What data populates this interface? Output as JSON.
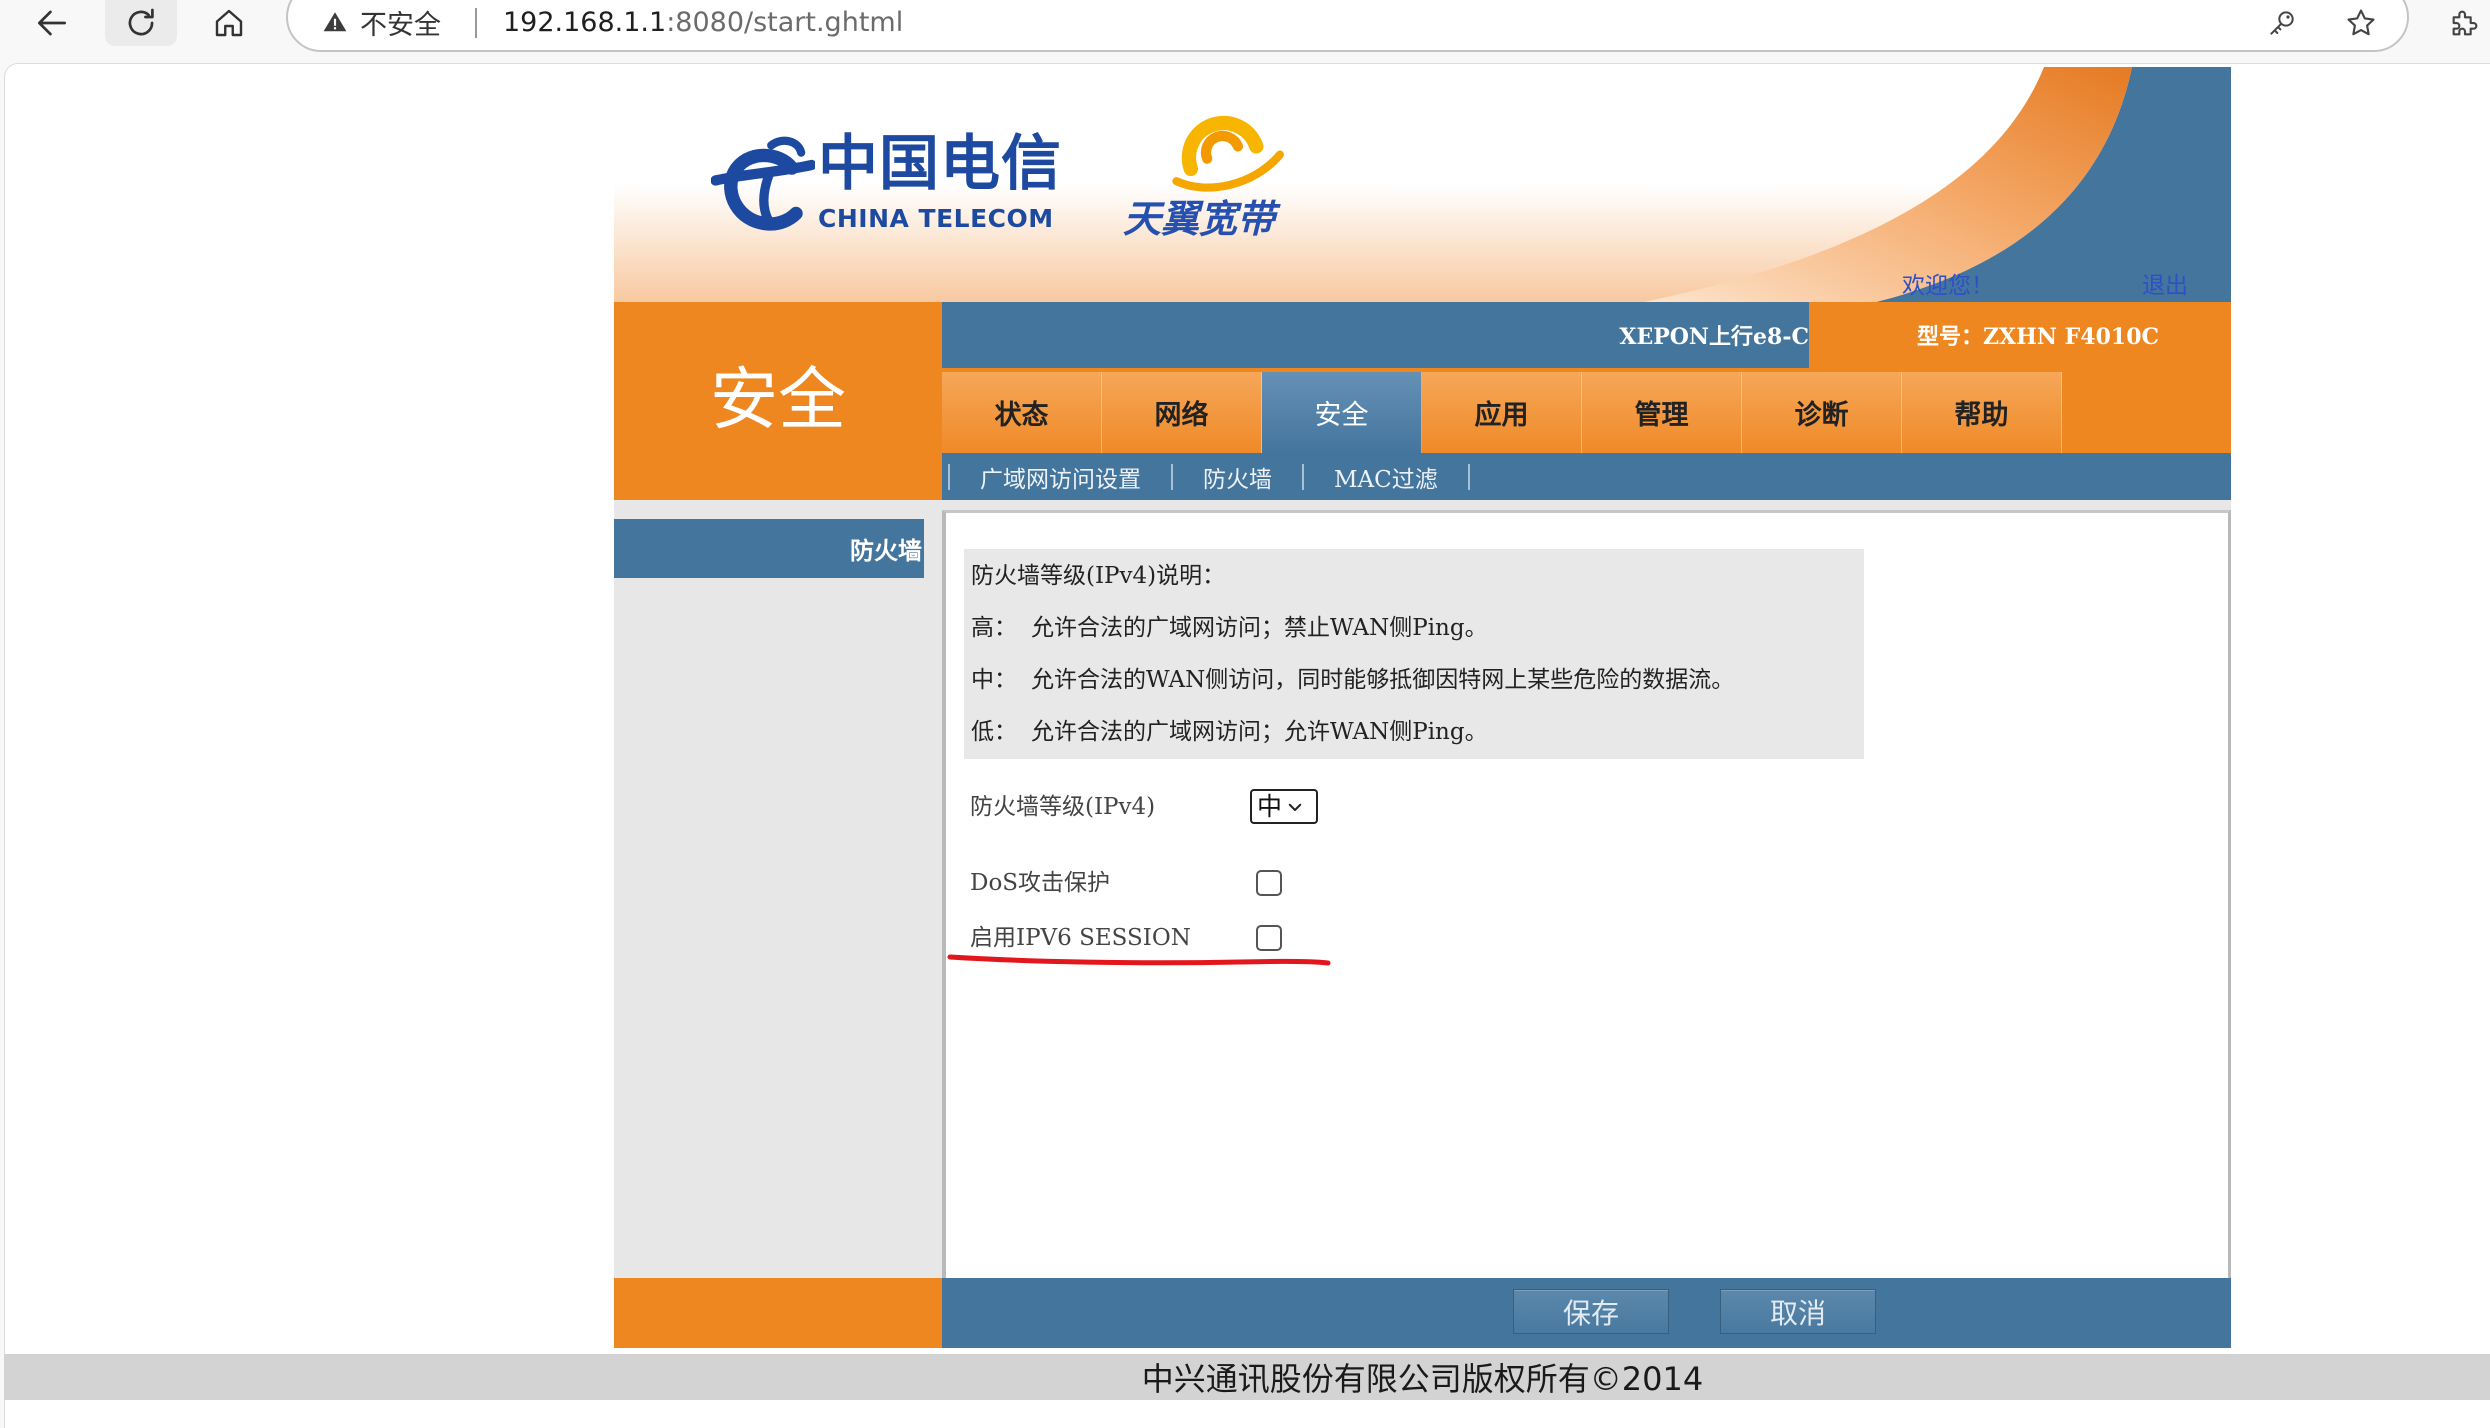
{
  "browser": {
    "security_label": "不安全",
    "url_host": "192.168.1.1",
    "url_path": ":8080/start.ghtml"
  },
  "icons": {
    "back": "back-arrow-icon",
    "reload": "reload-icon",
    "home": "home-icon",
    "security": "warning-triangle-icon",
    "password": "key-icon",
    "favorite": "star-icon",
    "extensions": "puzzle-icon",
    "logo": "china-telecom-logo-icon",
    "brand_logo": "tianyi-swirl-icon",
    "select_arrow": "chevron-down-icon"
  },
  "colors": {
    "orange": "#ef8720",
    "blue": "#44759d",
    "sidebar_gray": "#e7e7e7",
    "info_gray": "#e8e8e8",
    "annotation": "#e3161c",
    "logo_blue": "#1d4aa0",
    "welcome_blue": "#2f4fc8"
  },
  "header": {
    "logo_cn": "中国电信",
    "logo_en": "CHINA TELECOM",
    "brand": "天翼宽带",
    "welcome": "欢迎您！",
    "logout": "退出",
    "uplink": "XEPON上行e8-C",
    "model": "型号：ZXHN F4010C"
  },
  "section_title": "安全",
  "tabs": [
    {
      "label": "状态"
    },
    {
      "label": "网络"
    },
    {
      "label": "安全",
      "active": true
    },
    {
      "label": "应用"
    },
    {
      "label": "管理"
    },
    {
      "label": "诊断"
    },
    {
      "label": "帮助"
    }
  ],
  "subnav": [
    {
      "label": "广域网访问设置"
    },
    {
      "label": "防火墙"
    },
    {
      "label": "MAC过滤"
    }
  ],
  "sidebar": {
    "items": [
      {
        "label": "防火墙"
      }
    ]
  },
  "info": {
    "title": "防火墙等级(IPv4)说明：",
    "lines": [
      {
        "level": "高：",
        "text": "允许合法的广域网访问；禁止WAN侧Ping。"
      },
      {
        "level": "中：",
        "text": "允许合法的WAN侧访问，同时能够抵御因特网上某些危险的数据流。"
      },
      {
        "level": "低：",
        "text": "允许合法的广域网访问；允许WAN侧Ping。"
      }
    ]
  },
  "form": {
    "level_label": "防火墙等级(IPv4)",
    "level_value": "中",
    "dos_label": "DoS攻击保护",
    "dos_checked": false,
    "ipv6_label": "启用IPV6 SESSION",
    "ipv6_checked": false
  },
  "buttons": {
    "save": "保存",
    "cancel": "取消"
  },
  "footer": {
    "copyright": "中兴通讯股份有限公司版权所有©2014"
  }
}
